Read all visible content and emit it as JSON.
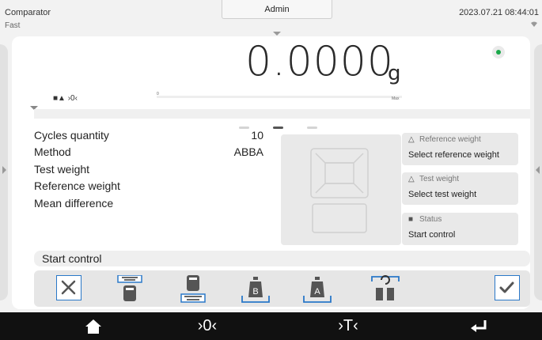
{
  "status_bar": {
    "mode": "Comparator",
    "submode": "Fast",
    "user": "Admin",
    "datetime": "2023.07.21 08:44:01"
  },
  "display": {
    "value": "0.0000",
    "unit": "g",
    "indicators": "■▲ ›0‹",
    "bar_min": "0",
    "bar_max": "Max"
  },
  "params": [
    {
      "label": "Cycles quantity",
      "value": "10"
    },
    {
      "label": "Method",
      "value": "ABBA"
    },
    {
      "label": "Test weight",
      "value": ""
    },
    {
      "label": "Reference weight",
      "value": ""
    },
    {
      "label": "Mean difference",
      "value": ""
    }
  ],
  "pages": {
    "count": 3,
    "active": 1
  },
  "cards": [
    {
      "title": "Reference weight",
      "value": "Select reference weight",
      "icon": "weight-icon"
    },
    {
      "title": "Test weight",
      "value": "Select test weight",
      "icon": "weight-icon"
    },
    {
      "title": "Status",
      "value": "Start control",
      "icon": "status-icon"
    }
  ],
  "prompt": "Start control",
  "toolbar": {
    "buttons": [
      {
        "name": "settings-tools-icon"
      },
      {
        "name": "print-header-icon"
      },
      {
        "name": "print-footer-icon"
      },
      {
        "name": "weight-b-icon",
        "letter": "B"
      },
      {
        "name": "weight-a-icon",
        "letter": "A"
      },
      {
        "name": "swap-weights-icon"
      },
      {
        "name": "confirm-icon"
      }
    ],
    "accent": "#2a78c8"
  },
  "bottom_nav": [
    {
      "name": "home-icon",
      "glyph": "⌂"
    },
    {
      "name": "zero-icon",
      "glyph": "›0‹"
    },
    {
      "name": "tare-icon",
      "glyph": "›T‹"
    },
    {
      "name": "enter-icon",
      "glyph": "↵"
    }
  ]
}
